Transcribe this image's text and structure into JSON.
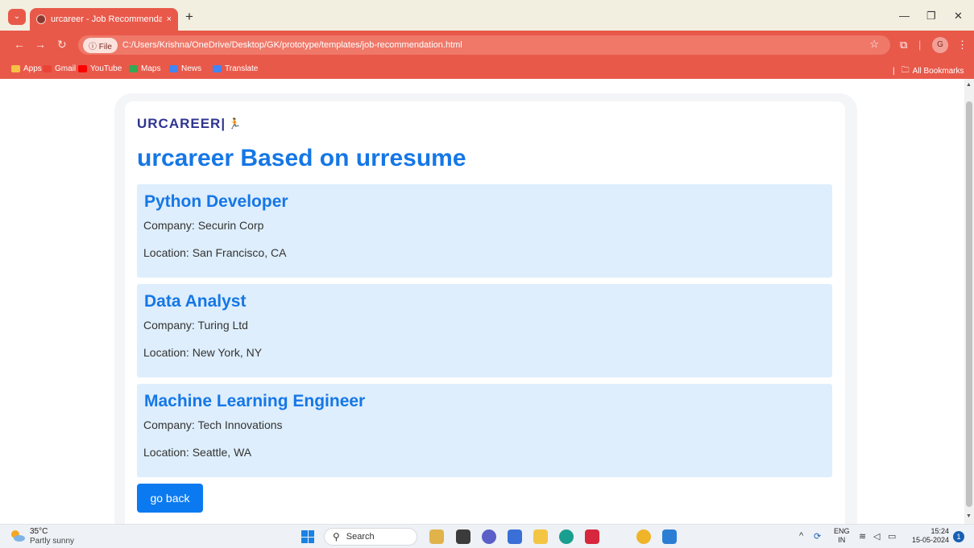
{
  "browser": {
    "tab_title": "urcareer - Job Recommendatio",
    "new_tab": "+",
    "tab_close": "×",
    "url_chip": "ⓘ File",
    "url": "C:/Users/Krishna/OneDrive/Desktop/GK/prototype/templates/job-recommendation.html",
    "profile_initial": "G",
    "bookmarks": [
      {
        "label": "Apps",
        "color": "#f6c244"
      },
      {
        "label": "Gmail",
        "color": "#ea4335"
      },
      {
        "label": "YouTube",
        "color": "#ff0000"
      },
      {
        "label": "Maps",
        "color": "#34a853"
      },
      {
        "label": "News",
        "color": "#4285f4"
      },
      {
        "label": "Translate",
        "color": "#4285f4"
      }
    ],
    "all_bookmarks": "All Bookmarks"
  },
  "page": {
    "logo": "URCAREER",
    "heading": "urcareer Based on urresume",
    "jobs": [
      {
        "title": "Python Developer",
        "company": "Company: Securin Corp",
        "location": "Location: San Francisco, CA"
      },
      {
        "title": "Data Analyst",
        "company": "Company: Turing Ltd",
        "location": "Location: New York, NY"
      },
      {
        "title": "Machine Learning Engineer",
        "company": "Company: Tech Innovations",
        "location": "Location: Seattle, WA"
      }
    ],
    "back_button": "go back"
  },
  "taskbar": {
    "temperature": "35°C",
    "weather": "Partly sunny",
    "search_placeholder": "Search",
    "lang_top": "ENG",
    "lang_bottom": "IN",
    "time": "15:24",
    "date": "15-05-2024",
    "notifications": "1"
  },
  "colors": {
    "chrome_accent": "#e8594a",
    "heading_blue": "#1577e6",
    "card_bg": "#deeefc",
    "button_blue": "#0b7af0",
    "logo_navy": "#2f3491"
  }
}
